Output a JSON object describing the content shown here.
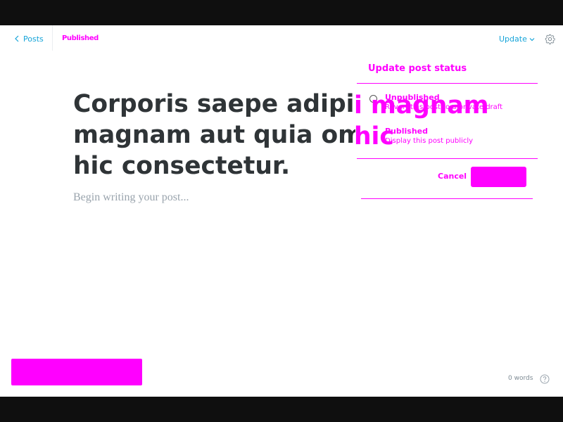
{
  "header": {
    "back_label": "Posts",
    "status_tag": "Published",
    "update_label": "Update"
  },
  "post": {
    "title": "Corporis saepe adipisci magnam aut quia omnis omnis hic consectetur.",
    "title_overlap": "i magnam hic",
    "body_placeholder": "Begin writing your post..."
  },
  "status_popover": {
    "heading": "Update post status",
    "options": [
      {
        "label": "Unpublished",
        "description": "Revert this post to a private draft",
        "selected": false
      },
      {
        "label": "Published",
        "description": "Display this post publicly",
        "selected": true
      }
    ],
    "cancel_label": "Cancel"
  },
  "footer": {
    "word_count": "0 words"
  },
  "icons": {
    "back": "chevron-left-icon",
    "dropdown": "chevron-down-icon",
    "settings": "gear-icon",
    "help": "question-circle-icon"
  },
  "colors": {
    "accent": "#15a4d9",
    "title": "#2f3437",
    "placeholder": "#9aa4ad",
    "highlight": "#ff00ff"
  }
}
